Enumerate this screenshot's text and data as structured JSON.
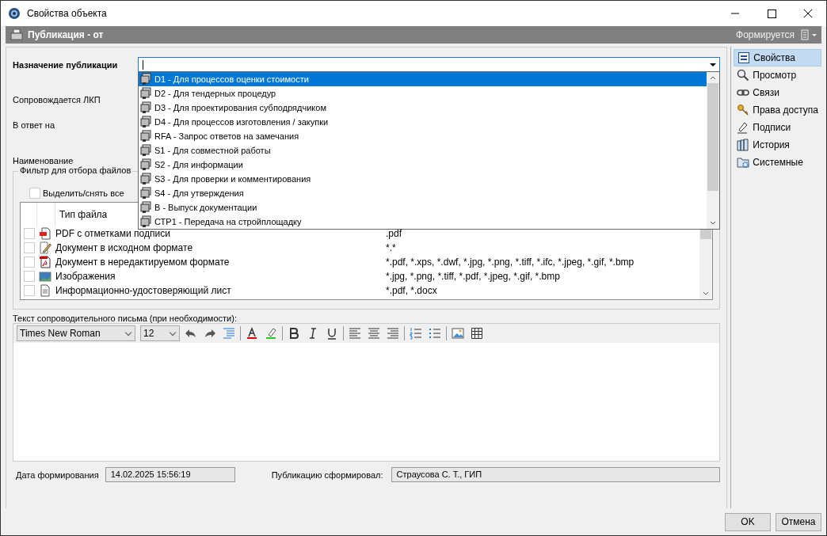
{
  "window": {
    "title": "Свойства объекта"
  },
  "header": {
    "title": "Публикация - от",
    "status": "Формируется"
  },
  "form": {
    "purpose_label": "Назначение публикации",
    "lkp_label": "Сопровождается ЛКП",
    "reply_label": "В ответ на",
    "name_label": "Наименование"
  },
  "dropdown": [
    {
      "label": "D1 - Для процессов оценки стоимости",
      "selected": true
    },
    {
      "label": "D2 - Для тендерных процедур",
      "selected": false
    },
    {
      "label": "D3 - Для проектирования субподрядчиком",
      "selected": false
    },
    {
      "label": "D4 - Для процессов изготовления / закупки",
      "selected": false
    },
    {
      "label": "RFA - Запрос ответов на замечания",
      "selected": false
    },
    {
      "label": "S1 - Для совместной работы",
      "selected": false
    },
    {
      "label": "S2 - Для информации",
      "selected": false
    },
    {
      "label": "S3 - Для проверки и комментирования",
      "selected": false
    },
    {
      "label": "S4 - Для утверждения",
      "selected": false
    },
    {
      "label": "B - Выпуск документации",
      "selected": false
    },
    {
      "label": "СТР1 - Передача на стройплощадку",
      "selected": false
    }
  ],
  "filter": {
    "title": "Фильтр для отбора файлов",
    "select_all": {
      "label": "Выделить/снять все",
      "checked": false
    },
    "columns": [
      "Тип файла"
    ],
    "rows": [
      {
        "kind": "pdf-stamp",
        "name": "PDF с отметками подписи",
        "extensions": ".pdf",
        "checked": false
      },
      {
        "kind": "edit",
        "name": "Документ в исходном формате",
        "extensions": "*.*",
        "checked": false
      },
      {
        "kind": "pdf",
        "name": "Документ в нередактируемом формате",
        "extensions": "*.pdf, *.xps, *.dwf, *.jpg, *.png, *.tiff, *.ifc,  *.jpeg, *.gif, *.bmp",
        "checked": false
      },
      {
        "kind": "image",
        "name": "Изображения",
        "extensions": "*.jpg, *.png, *.tiff, *.pdf,  *.jpeg, *.gif, *.bmp",
        "checked": false
      },
      {
        "kind": "doc",
        "name": "Информационно-удостоверяющий лист",
        "extensions": "*.pdf, *.docx",
        "checked": false
      }
    ]
  },
  "editor": {
    "label": "Текст сопроводительного письма (при необходимости):",
    "font": "Times New Roman",
    "size": "12"
  },
  "footer": {
    "date_label": "Дата формирования",
    "date_value": "14.02.2025 15:56:19",
    "author_label": "Публикацию сформировал:",
    "author_value": "Страусова С. Т., ГИП"
  },
  "sidebar": [
    {
      "kind": "properties",
      "label": "Свойства",
      "selected": true
    },
    {
      "kind": "view",
      "label": "Просмотр",
      "selected": false
    },
    {
      "kind": "links",
      "label": "Связи",
      "selected": false
    },
    {
      "kind": "access",
      "label": "Права доступа",
      "selected": false
    },
    {
      "kind": "signatures",
      "label": "Подписи",
      "selected": false
    },
    {
      "kind": "history",
      "label": "История",
      "selected": false
    },
    {
      "kind": "system",
      "label": "Системные",
      "selected": false
    }
  ],
  "buttons": [
    "OK",
    "Отмена"
  ]
}
